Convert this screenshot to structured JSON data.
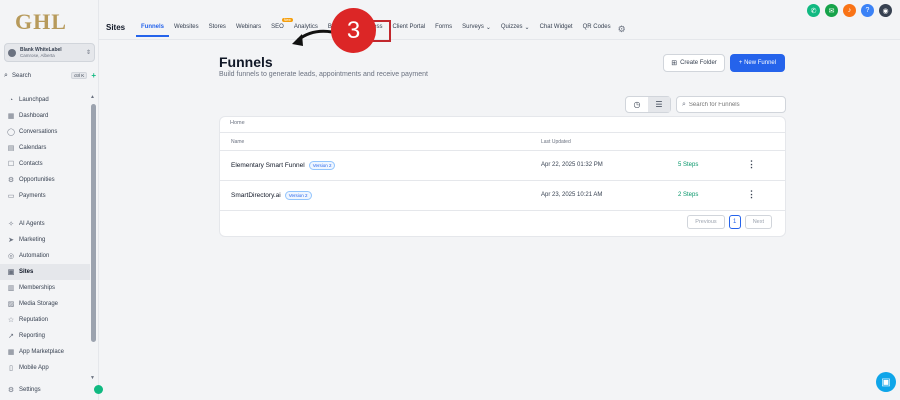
{
  "brand": {
    "logo_text": "GHL",
    "logo_color": "#b79a5b"
  },
  "account": {
    "name": "Blank WhiteLabel",
    "location": "Camrose, Alberta"
  },
  "search": {
    "label": "Search",
    "shortcut": "ctrl K"
  },
  "sidebar": {
    "items": [
      {
        "label": "Launchpad",
        "icon": "rocket-icon",
        "glyph": "◔"
      },
      {
        "label": "Dashboard",
        "icon": "grid-icon",
        "glyph": "▦"
      },
      {
        "label": "Conversations",
        "icon": "chat-icon",
        "glyph": "◯"
      },
      {
        "label": "Calendars",
        "icon": "calendar-icon",
        "glyph": "▤"
      },
      {
        "label": "Contacts",
        "icon": "contacts-icon",
        "glyph": "☐"
      },
      {
        "label": "Opportunities",
        "icon": "opportunities-icon",
        "glyph": "⚙"
      },
      {
        "label": "Payments",
        "icon": "payments-icon",
        "glyph": "▭"
      },
      {
        "label": "AI Agents",
        "icon": "ai-icon",
        "glyph": "✧"
      },
      {
        "label": "Marketing",
        "icon": "send-icon",
        "glyph": "➤"
      },
      {
        "label": "Automation",
        "icon": "automation-icon",
        "glyph": "◎"
      },
      {
        "label": "Sites",
        "icon": "sites-icon",
        "glyph": "▣"
      },
      {
        "label": "Memberships",
        "icon": "memberships-icon",
        "glyph": "▥"
      },
      {
        "label": "Media Storage",
        "icon": "media-icon",
        "glyph": "▨"
      },
      {
        "label": "Reputation",
        "icon": "star-icon",
        "glyph": "☆"
      },
      {
        "label": "Reporting",
        "icon": "chart-icon",
        "glyph": "↗"
      },
      {
        "label": "App Marketplace",
        "icon": "apps-icon",
        "glyph": "▦"
      },
      {
        "label": "Mobile App",
        "icon": "mobile-icon",
        "glyph": "▯"
      }
    ],
    "settings_label": "Settings"
  },
  "topnav": {
    "section_title": "Sites",
    "tabs": [
      {
        "label": "Funnels"
      },
      {
        "label": "Websites"
      },
      {
        "label": "Stores"
      },
      {
        "label": "Webinars"
      },
      {
        "label": "SEO",
        "badge": "New"
      },
      {
        "label": "Analytics"
      },
      {
        "label": "Blogs"
      },
      {
        "label": "WordPress"
      },
      {
        "label": "Client Portal"
      },
      {
        "label": "Forms"
      },
      {
        "label": "Surveys"
      },
      {
        "label": "Quizzes"
      },
      {
        "label": "Chat Widget"
      },
      {
        "label": "QR Codes"
      }
    ],
    "callout_number": "3"
  },
  "header_icons": [
    {
      "icon": "phone-icon",
      "color": "#10b981",
      "glyph": "✆"
    },
    {
      "icon": "megaphone-icon",
      "color": "#16a34a",
      "glyph": "✉"
    },
    {
      "icon": "bell-icon",
      "color": "#f97316",
      "glyph": "♪"
    },
    {
      "icon": "help-icon",
      "color": "#3b82f6",
      "glyph": "?"
    },
    {
      "icon": "avatar-icon",
      "color": "#374151",
      "glyph": "◉"
    }
  ],
  "main": {
    "title": "Funnels",
    "subtitle": "Build funnels to generate leads, appointments and receive payment",
    "create_folder_label": "Create Folder",
    "new_funnel_label": "+ New Funnel",
    "search_placeholder": "Search for Funnels",
    "breadcrumb": "Home",
    "columns": {
      "name": "Name",
      "last_updated": "Last Updated"
    },
    "rows": [
      {
        "name": "Elementary Smart Funnel",
        "version": "Version 2",
        "last_updated": "Apr 22, 2025 01:32 PM",
        "steps": "5 Steps"
      },
      {
        "name": "SmartDirectory.ai",
        "version": "Version 2",
        "last_updated": "Apr 23, 2025 10:21 AM",
        "steps": "2 Steps"
      }
    ],
    "pagination": {
      "previous": "Previous",
      "page": "1",
      "next": "Next"
    }
  }
}
